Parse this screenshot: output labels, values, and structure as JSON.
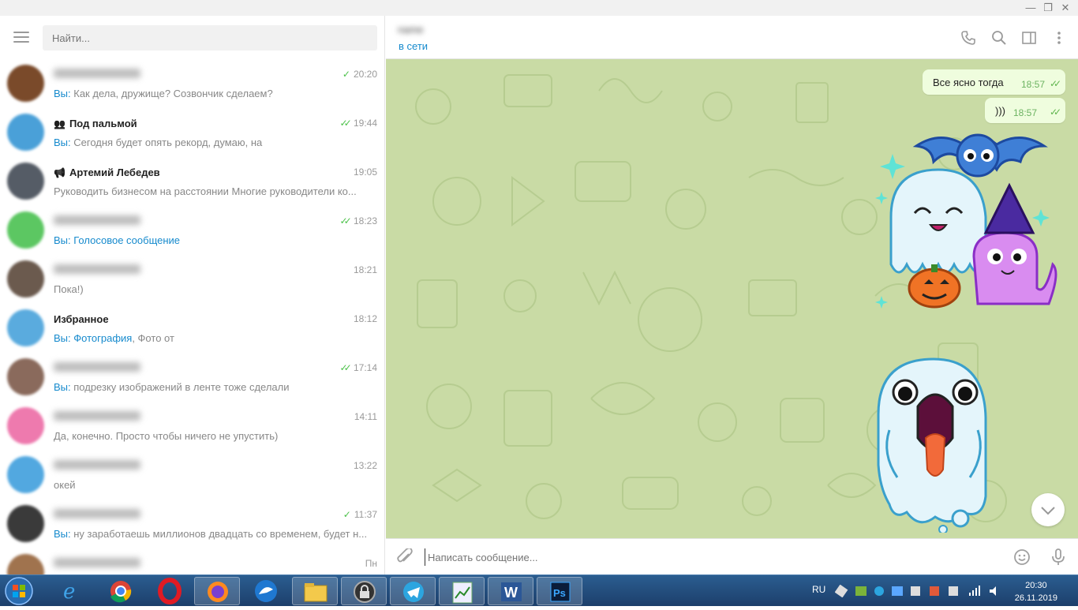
{
  "window": {
    "minimize": "—",
    "maximize": "❐",
    "close": "✕"
  },
  "search": {
    "placeholder": "Найти..."
  },
  "chats": [
    {
      "name": "",
      "time": "20:20",
      "check": "single",
      "you": "Вы: ",
      "preview": "Как дела, дружище? Созвончик сделаем?",
      "avatar_color": "#7a4a2a",
      "name_blur": true
    },
    {
      "name": "Под пальмой",
      "time": "19:44",
      "check": "double",
      "you": "Вы: ",
      "preview": "Сегодня будет опять рекорд, думаю, на",
      "avatar_color": "#4aa0d8",
      "name_blur": false,
      "icon": "group-icon"
    },
    {
      "name": "Артемий Лебедев",
      "time": "19:05",
      "check": "none",
      "you": "",
      "preview": "Руководить бизнесом на расстоянии  Многие руководители ко...",
      "avatar_color": "#555c66",
      "name_blur": false,
      "icon": "channel-icon"
    },
    {
      "name": "",
      "time": "18:23",
      "check": "double",
      "you": "Вы: ",
      "preview": "Голосовое сообщение",
      "preview_link": true,
      "avatar_color": "#5cc762",
      "name_blur": true
    },
    {
      "name": "",
      "time": "18:21",
      "check": "none",
      "you": "",
      "preview": "Пока!)",
      "avatar_color": "#6b5a4e",
      "name_blur": true
    },
    {
      "name": "Избранное",
      "time": "18:12",
      "check": "none",
      "you": "Вы: ",
      "preview": "Фотография",
      "preview_link": true,
      "preview_tail": ", Фото от",
      "avatar_color": "#5aabde",
      "name_blur": false
    },
    {
      "name": "",
      "time": "17:14",
      "check": "double",
      "you": "Вы: ",
      "preview": "подрезку изображений в ленте тоже сделали",
      "avatar_color": "#8a6a5c",
      "name_blur": true
    },
    {
      "name": "",
      "time": "14:11",
      "check": "none",
      "you": "",
      "preview": "Да, конечно. Просто чтобы ничего не упустить)",
      "avatar_color": "#ee7aae",
      "name_blur": true
    },
    {
      "name": "",
      "time": "13:22",
      "check": "none",
      "you": "",
      "preview": "окей",
      "avatar_color": "#52a8e0",
      "name_blur": true
    },
    {
      "name": "",
      "time": "11:37",
      "check": "single",
      "you": "Вы: ",
      "preview": "ну заработаешь миллионов двадцать со временем, будет н...",
      "avatar_color": "#3a3a3a",
      "name_blur": true
    },
    {
      "name": "",
      "time": "Пн",
      "check": "none",
      "you": "",
      "preview": "",
      "avatar_color": "#a0734e",
      "name_blur": true
    }
  ],
  "peer": {
    "status": "в сети"
  },
  "messages": [
    {
      "text": "Все ясно тогда",
      "time": "18:57"
    },
    {
      "text": ")))",
      "time": "18:57"
    }
  ],
  "composer": {
    "placeholder": "Написать сообщение..."
  },
  "taskbar": {
    "lang": "RU",
    "time": "20:30",
    "date": "26.11.2019"
  }
}
